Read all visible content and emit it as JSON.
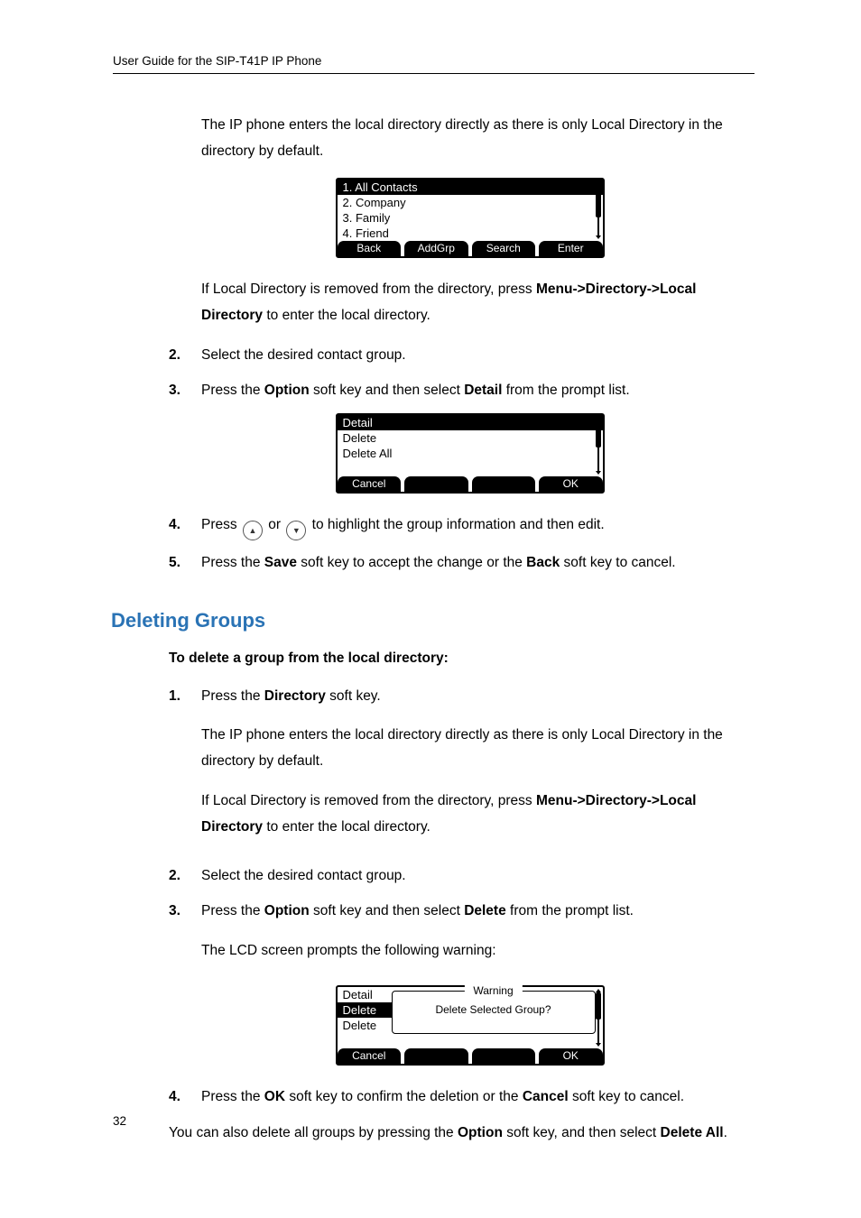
{
  "header": "User Guide for the SIP-T41P IP Phone",
  "page_number": "32",
  "section_heading": "Deleting Groups",
  "sub_heading": "To delete a group from the local directory:",
  "paras": {
    "p_enter_local": "The IP phone enters the local directory directly as there is only Local Directory in the directory by default.",
    "p_removed_pre": "If Local Directory is removed from the directory, press ",
    "p_removed_path": "Menu->Directory->Local Directory",
    "p_removed_suf": " to enter the local directory.",
    "p_lcd_prompts": "The LCD screen prompts the following warning:",
    "p_also_delete_pre": "You can also delete all groups by pressing the ",
    "p_also_delete_mid": " soft key, and then select ",
    "p_also_delete_end": "."
  },
  "steps_top": {
    "s2": "Select the desired contact group.",
    "s3_pre": "Press the ",
    "s3_mid": " soft key and then select ",
    "s3_suf": " from the prompt list.",
    "s4_pre": "Press ",
    "s4_mid": "  to highlight the group information and then edit.",
    "s4_or": " or ",
    "s5_pre": "Press the ",
    "s5_mid": " soft key to accept the change or the ",
    "s5_suf": " soft key to cancel."
  },
  "steps_del": {
    "s1_pre": "Press the ",
    "s1_suf": " soft key.",
    "s2": "Select the desired contact group.",
    "s3_pre": "Press the ",
    "s3_mid": " soft key and then select ",
    "s3_suf": " from the prompt list.",
    "s4_pre": "Press the ",
    "s4_mid": " soft key to confirm the deletion or the ",
    "s4_suf": " soft key to cancel."
  },
  "keys": {
    "menu": "Menu",
    "directory_word": "Directory",
    "local_directory": "Local Directory",
    "option": "Option",
    "detail": "Detail",
    "delete": "Delete",
    "save": "Save",
    "back": "Back",
    "ok": "OK",
    "cancel": "Cancel",
    "delete_all": "Delete All"
  },
  "nums": {
    "n1": "1.",
    "n2": "2.",
    "n3": "3.",
    "n4": "4.",
    "n5": "5."
  },
  "lcd1": {
    "rows": [
      "1. All Contacts",
      "2. Company",
      "3. Family",
      "4. Friend"
    ],
    "softkeys": [
      "Back",
      "AddGrp",
      "Search",
      "Enter"
    ]
  },
  "lcd2": {
    "rows": [
      "Detail",
      "Delete",
      "Delete All"
    ],
    "softkeys": [
      "Cancel",
      "",
      "",
      "OK"
    ]
  },
  "lcd3": {
    "under_rows": [
      "Detail",
      "Delete",
      "Delete"
    ],
    "warning_title": "Warning",
    "warning_msg": "Delete Selected Group?",
    "softkeys": [
      "Cancel",
      "",
      "",
      "OK"
    ]
  }
}
